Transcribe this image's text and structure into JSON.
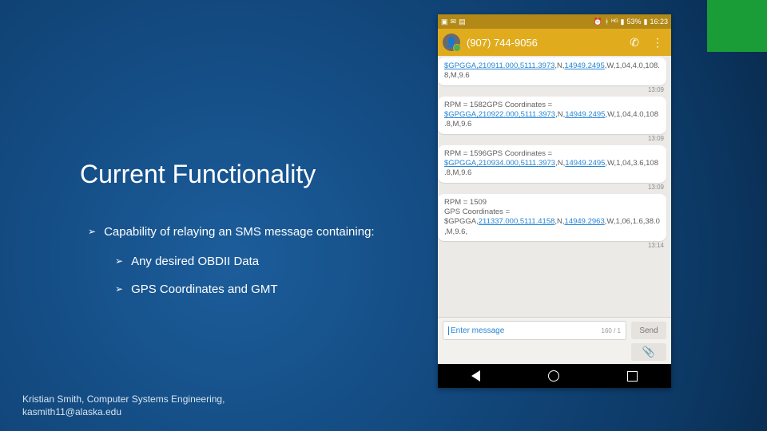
{
  "title": "Current Functionality",
  "main_bullet": "Capability of relaying an SMS message containing:",
  "sub_bullets": {
    "b1": "Any desired OBDII Data",
    "b2": "GPS Coordinates and GMT"
  },
  "footer": {
    "line1": "Kristian Smith, Computer Systems Engineering,",
    "line2": "kasmith11@alaska.edu"
  },
  "phone": {
    "status": {
      "battery": "53%",
      "time": "16:23"
    },
    "number": "(907) 744-9056",
    "messages": [
      {
        "text_plain1": "",
        "text_link": "$GPGGA,210911.000,5111.3973",
        "text_plain2": ",N,",
        "text_link2": "14949.2495",
        "text_plain3": ",W,1,04,4.0,108.8,M,9.6",
        "time": "13:09"
      },
      {
        "text_plain1": "RPM = 1582GPS Coordinates = ",
        "text_link": "$GPGGA,210922.000,5111.3973",
        "text_plain2": ",N,",
        "text_link2": "14949.2495",
        "text_plain3": ",W,1,04,4.0,108.8,M,9.6",
        "time": "13:09"
      },
      {
        "text_plain1": "RPM = 1596GPS Coordinates = ",
        "text_link": "$GPGGA,210934.000,5111.3973",
        "text_plain2": ",N,",
        "text_link2": "14949.2495",
        "text_plain3": ",W,1,04,3.6,108.8,M,9.6",
        "time": "13:09"
      },
      {
        "text_plain1": "RPM = 1509\nGPS Coordinates = $GPGGA,",
        "text_link": "211337.000,5111.4158",
        "text_plain2": ",N,",
        "text_link2": "14949.2963",
        "text_plain3": ",W,1,06,1.6,38.0,M,9.6,",
        "time": "13:14"
      }
    ],
    "compose": {
      "placeholder": "Enter message",
      "counter": "160 / 1",
      "send": "Send"
    }
  }
}
